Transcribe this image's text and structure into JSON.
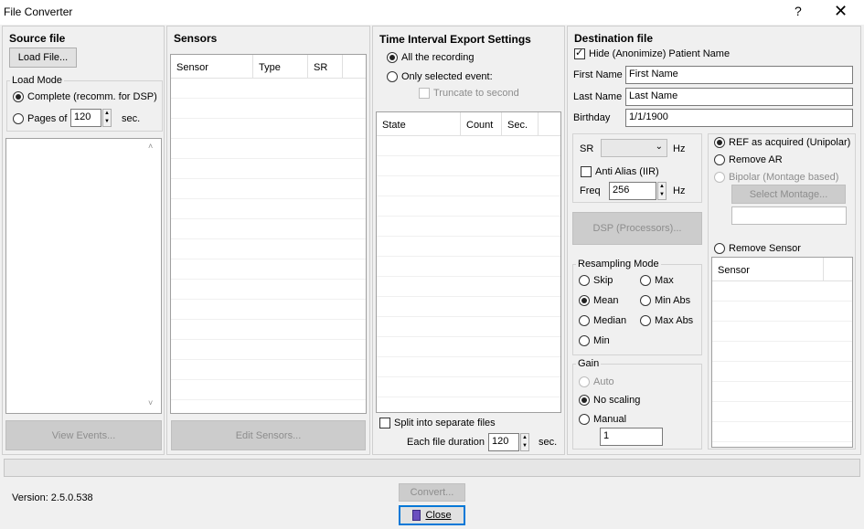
{
  "window": {
    "title": "File Converter",
    "help": "?",
    "close": "✕"
  },
  "source": {
    "title": "Source file",
    "load_button": "Load File...",
    "load_mode_label": "Load Mode",
    "complete_label": "Complete (recomm. for DSP)",
    "pages_label": "Pages of",
    "pages_value": "120",
    "sec_label": "sec.",
    "view_events": "View Events..."
  },
  "sensors": {
    "title": "Sensors",
    "columns": [
      "Sensor",
      "Type",
      "SR"
    ],
    "edit_button": "Edit Sensors..."
  },
  "time": {
    "title": "Time Interval Export Settings",
    "all_label": "All the recording",
    "selected_label": "Only selected event:",
    "truncate_label": "Truncate to second",
    "columns": [
      "State",
      "Count",
      "Sec."
    ],
    "split_label": "Split into separate files",
    "duration_label": "Each file duration",
    "duration_value": "120",
    "sec_label": "sec."
  },
  "dest": {
    "title": "Destination file",
    "hide_label": "Hide (Anonimize) Patient Name",
    "first_name_label": "First Name",
    "first_name_value": "First Name",
    "last_name_label": "Last Name",
    "last_name_value": "Last Name",
    "birthday_label": "Birthday",
    "birthday_value": "1/1/1900",
    "sr_label": "SR",
    "hz": "Hz",
    "anti_alias_label": "Anti Alias (IIR)",
    "freq_label": "Freq",
    "freq_value": "256",
    "dsp_button": "DSP (Processors)...",
    "resampling_label": "Resampling Mode",
    "skip": "Skip",
    "max": "Max",
    "mean": "Mean",
    "min_abs": "Min Abs",
    "median": "Median",
    "max_abs": "Max Abs",
    "min": "Min",
    "gain_label": "Gain",
    "auto": "Auto",
    "no_scaling": "No scaling",
    "manual": "Manual",
    "manual_value": "1",
    "ref_label": "REF as acquired (Unipolar)",
    "remove_ar": "Remove AR",
    "bipolar": "Bipolar (Montage based)",
    "select_montage": "Select Montage...",
    "remove_sensor": "Remove Sensor",
    "sensor_col": "Sensor"
  },
  "footer": {
    "version": "Version: 2.5.0.538",
    "convert": "Convert...",
    "close": "Close"
  }
}
